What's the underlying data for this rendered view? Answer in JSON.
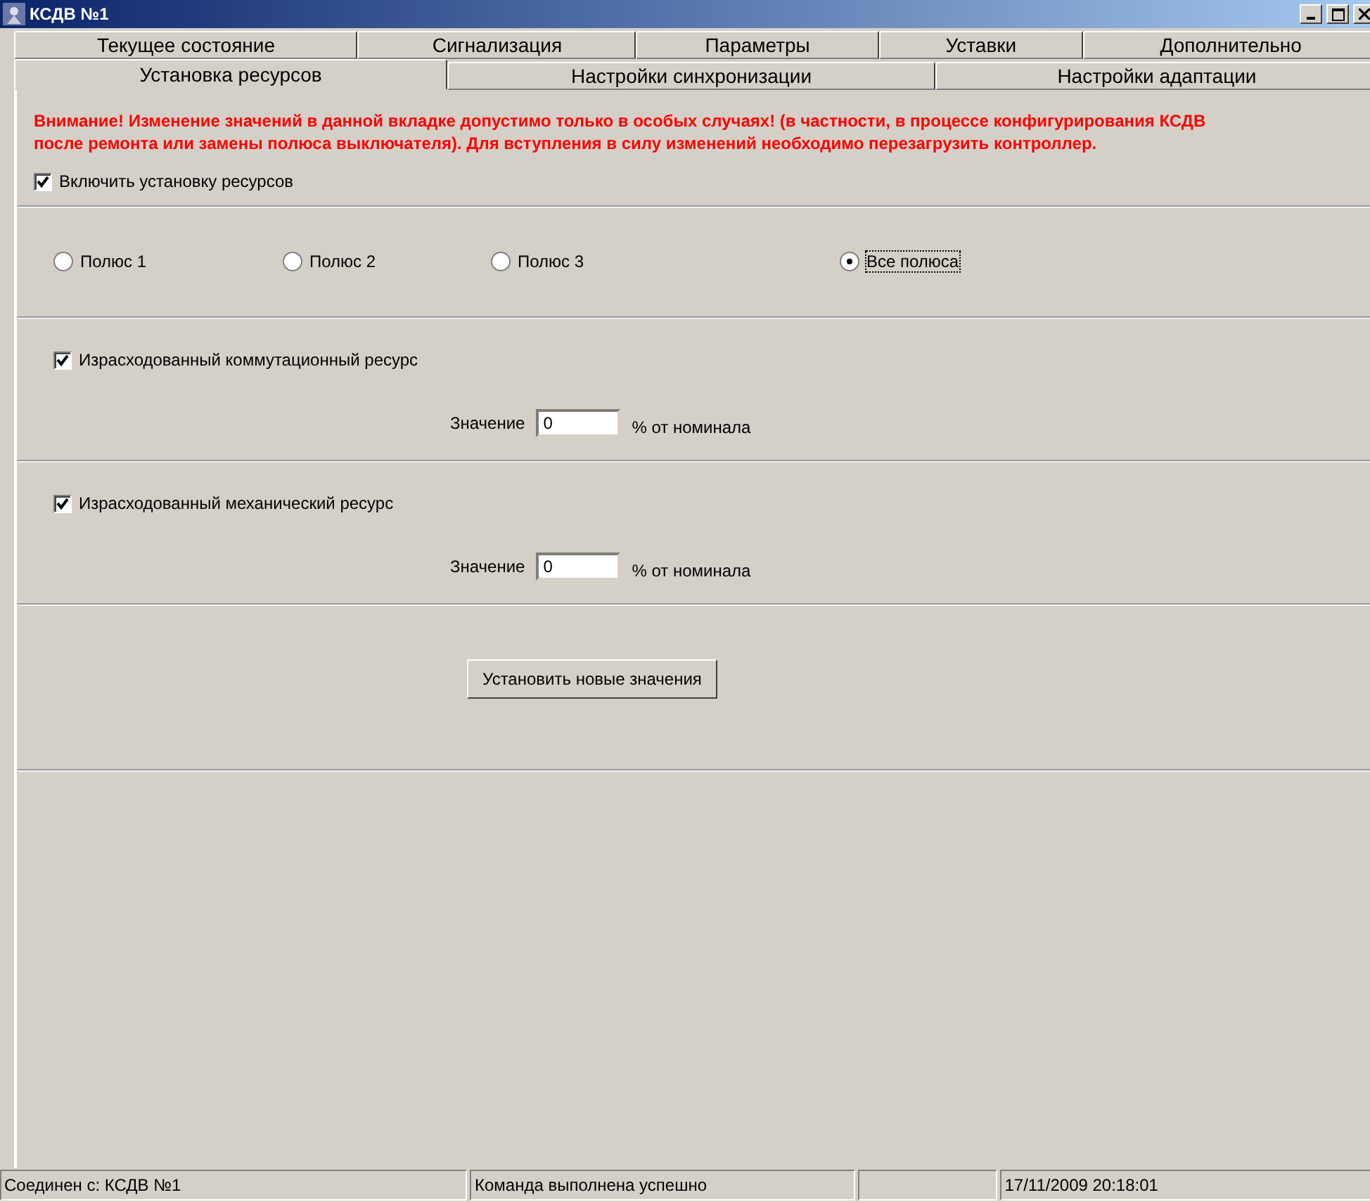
{
  "window": {
    "title": "КСДВ №1"
  },
  "tab_rows": [
    [
      {
        "label": "Текущее состояние",
        "selected": false
      },
      {
        "label": "Сигнализация",
        "selected": false
      },
      {
        "label": "Параметры",
        "selected": false
      },
      {
        "label": "Уставки",
        "selected": false
      },
      {
        "label": "Дополнительно",
        "selected": false
      }
    ],
    [
      {
        "label": "Установка ресурсов",
        "selected": true
      },
      {
        "label": "Настройки синхронизации",
        "selected": false
      },
      {
        "label": "Настройки адаптации",
        "selected": false
      }
    ]
  ],
  "warning": "Внимание!   Изменение значений в данной вкладке допустимо только в особых случаях! (в частности, в процессе конфигурирования КСДВ после ремонта или замены полюса выключателя). Для вступления в силу изменений необходимо перезагрузить контроллер.",
  "enable": {
    "label": "Включить установку ресурсов",
    "checked": true
  },
  "poles": [
    {
      "label": "Полюс 1",
      "selected": false
    },
    {
      "label": "Полюс 2",
      "selected": false
    },
    {
      "label": "Полюс 3",
      "selected": false
    },
    {
      "label": "Все полюса",
      "selected": true
    }
  ],
  "resources": [
    {
      "label": "Израсходованный коммутационный ресурс",
      "checked": true,
      "value_label": "Значение",
      "value": "0",
      "unit": "% от номинала"
    },
    {
      "label": "Израсходованный механический ресурс",
      "checked": true,
      "value_label": "Значение",
      "value": "0",
      "unit": "% от номинала"
    }
  ],
  "apply_button": "Установить новые значения",
  "status_bar": [
    "Соединен с: КСДВ №1",
    "Команда выполнена успешно",
    "17/11/2009  20:18:01"
  ]
}
